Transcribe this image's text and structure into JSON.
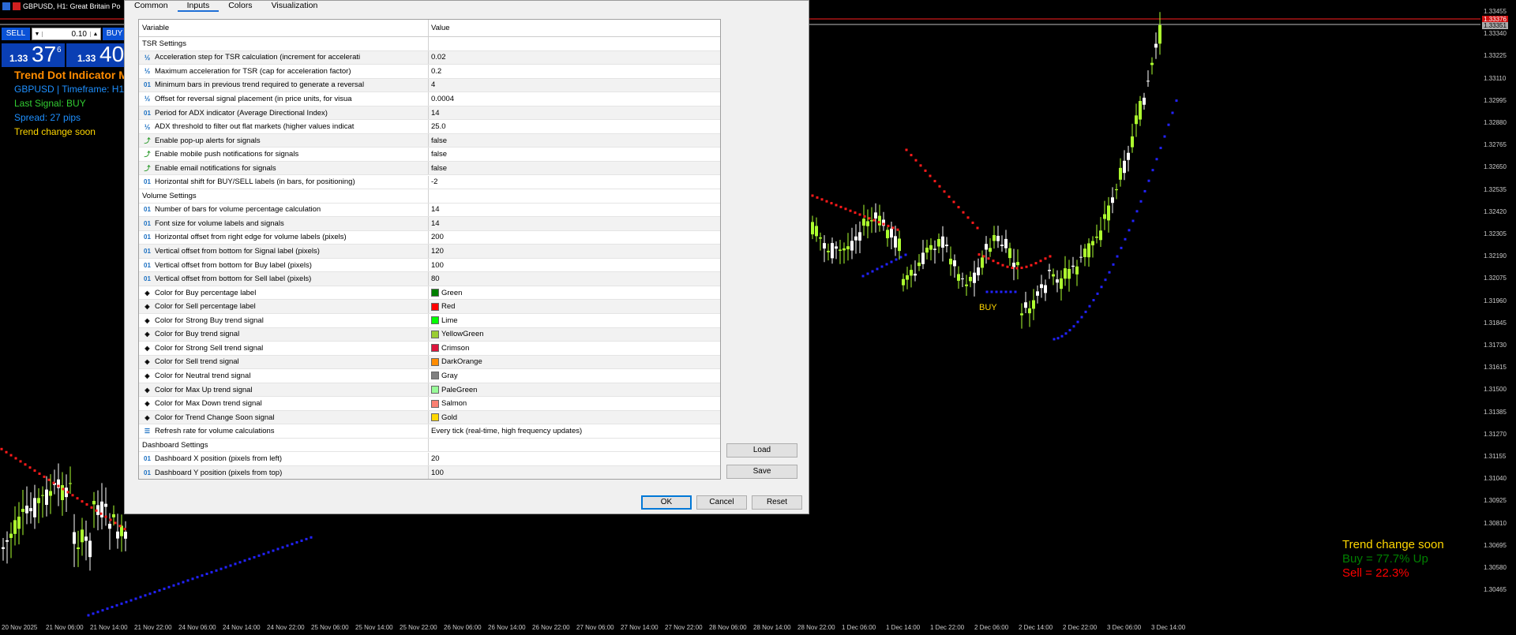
{
  "window": {
    "symbol_title": "GBPUSD, H1:  Great Britain Po"
  },
  "one_click": {
    "sell_label": "SELL",
    "buy_label": "BUY",
    "lot": "0.10",
    "sell_price_small": "1.33",
    "sell_price_big": "37",
    "sell_price_sup": "6",
    "buy_price_small": "1.33",
    "buy_price_big": "40"
  },
  "dashboard": {
    "title": "Trend Dot Indicator M",
    "symbol_line": "GBPUSD | Timeframe: H1",
    "last_signal": "Last Signal: BUY",
    "spread": "Spread: 27 pips",
    "trend": "Trend change soon"
  },
  "bottom_right": {
    "trend": "Trend change soon",
    "buy": "Buy = 77.7% Up",
    "sell": "Sell = 22.3%"
  },
  "chart_label": "BUY",
  "colors": {
    "dashboard_title": "#ff8c00",
    "symbol_line": "#1e90ff",
    "last_signal": "#32cd32",
    "spread": "#1e90ff",
    "trend": "#ffd700",
    "bull_candle": "#adff2f",
    "bear_candle": "#ffffff",
    "dot_red": "#ff1a1a",
    "dot_blue": "#2222ff"
  },
  "y_axis": [
    "1.33455",
    "1.33340",
    "1.33225",
    "1.33110",
    "1.32995",
    "1.32880",
    "1.32765",
    "1.32650",
    "1.32535",
    "1.32420",
    "1.32305",
    "1.32190",
    "1.32075",
    "1.31960",
    "1.31845",
    "1.31730",
    "1.31615",
    "1.31500",
    "1.31385",
    "1.31270",
    "1.31155",
    "1.31040",
    "1.30925",
    "1.30810",
    "1.30695",
    "1.30580",
    "1.30465"
  ],
  "price_tags": [
    "1.33376",
    "1.33351"
  ],
  "x_axis": [
    "20 Nov 2025",
    "21 Nov 06:00",
    "21 Nov 14:00",
    "21 Nov 22:00",
    "24 Nov 06:00",
    "24 Nov 14:00",
    "24 Nov 22:00",
    "25 Nov 06:00",
    "25 Nov 14:00",
    "25 Nov 22:00",
    "26 Nov 06:00",
    "26 Nov 14:00",
    "26 Nov 22:00",
    "27 Nov 06:00",
    "27 Nov 14:00",
    "27 Nov 22:00",
    "28 Nov 06:00",
    "28 Nov 14:00",
    "28 Nov 22:00",
    "1 Dec 06:00",
    "1 Dec 14:00",
    "1 Dec 22:00",
    "2 Dec 06:00",
    "2 Dec 14:00",
    "2 Dec 22:00",
    "3 Dec 06:00",
    "3 Dec 14:00"
  ],
  "dialog": {
    "tabs": [
      "Common",
      "Inputs",
      "Colors",
      "Visualization"
    ],
    "active_tab": "Inputs",
    "col_variable": "Variable",
    "col_value": "Value",
    "rows": [
      {
        "type": "section",
        "label": "TSR Settings",
        "value": ""
      },
      {
        "type": "frac",
        "label": "Acceleration step for TSR calculation (increment for accelerati",
        "value": "0.02"
      },
      {
        "type": "frac",
        "label": "Maximum acceleration for TSR (cap for acceleration factor)",
        "value": "0.2"
      },
      {
        "type": "num",
        "label": "Minimum bars in previous trend required to generate a reversal",
        "value": "4"
      },
      {
        "type": "frac",
        "label": "Offset for reversal signal placement (in price units, for visua",
        "value": "0.0004"
      },
      {
        "type": "num",
        "label": "Period for ADX indicator (Average Directional Index)",
        "value": "14"
      },
      {
        "type": "frac",
        "label": "ADX threshold to filter out flat markets (higher values indicat",
        "value": "25.0"
      },
      {
        "type": "bool",
        "label": "Enable pop-up alerts for signals",
        "value": "false"
      },
      {
        "type": "bool",
        "label": "Enable mobile push notifications for signals",
        "value": "false"
      },
      {
        "type": "bool",
        "label": "Enable email notifications for signals",
        "value": "false"
      },
      {
        "type": "num",
        "label": "Horizontal shift for BUY/SELL labels (in bars, for positioning)",
        "value": "-2"
      },
      {
        "type": "section",
        "label": "Volume Settings",
        "value": ""
      },
      {
        "type": "num",
        "label": "Number of bars for volume percentage calculation",
        "value": "14"
      },
      {
        "type": "num",
        "label": "Font size for volume labels and signals",
        "value": "14"
      },
      {
        "type": "num",
        "label": "Horizontal offset from right edge for volume labels (pixels)",
        "value": "200"
      },
      {
        "type": "num",
        "label": "Vertical offset from bottom for Signal label (pixels)",
        "value": "120"
      },
      {
        "type": "num",
        "label": "Vertical offset from bottom for Buy label (pixels)",
        "value": "100"
      },
      {
        "type": "num",
        "label": "Vertical offset from bottom for Sell label (pixels)",
        "value": "80"
      },
      {
        "type": "color",
        "label": "Color for Buy percentage label",
        "value": "Green",
        "swatch": "#008000"
      },
      {
        "type": "color",
        "label": "Color for Sell percentage label",
        "value": "Red",
        "swatch": "#ff0000"
      },
      {
        "type": "color",
        "label": "Color for Strong Buy trend signal",
        "value": "Lime",
        "swatch": "#00ff00"
      },
      {
        "type": "color",
        "label": "Color for Buy trend signal",
        "value": "YellowGreen",
        "swatch": "#9acd32"
      },
      {
        "type": "color",
        "label": "Color for Strong Sell trend signal",
        "value": "Crimson",
        "swatch": "#dc143c"
      },
      {
        "type": "color",
        "label": "Color for Sell trend signal",
        "value": "DarkOrange",
        "swatch": "#ff8c00"
      },
      {
        "type": "color",
        "label": "Color for Neutral trend signal",
        "value": "Gray",
        "swatch": "#808080"
      },
      {
        "type": "color",
        "label": "Color for Max Up trend signal",
        "value": "PaleGreen",
        "swatch": "#98fb98"
      },
      {
        "type": "color",
        "label": "Color for Max Down trend signal",
        "value": "Salmon",
        "swatch": "#fa8072"
      },
      {
        "type": "color",
        "label": "Color for Trend Change Soon signal",
        "value": "Gold",
        "swatch": "#ffd700"
      },
      {
        "type": "enum",
        "label": "Refresh rate for volume calculations",
        "value": "Every tick (real-time, high frequency updates)"
      },
      {
        "type": "section",
        "label": "Dashboard Settings",
        "value": ""
      },
      {
        "type": "num",
        "label": "Dashboard X position (pixels from left)",
        "value": "20"
      },
      {
        "type": "num",
        "label": "Dashboard Y position (pixels from top)",
        "value": "100"
      }
    ],
    "load_label": "Load",
    "save_label": "Save",
    "ok_label": "OK",
    "cancel_label": "Cancel",
    "reset_label": "Reset"
  }
}
